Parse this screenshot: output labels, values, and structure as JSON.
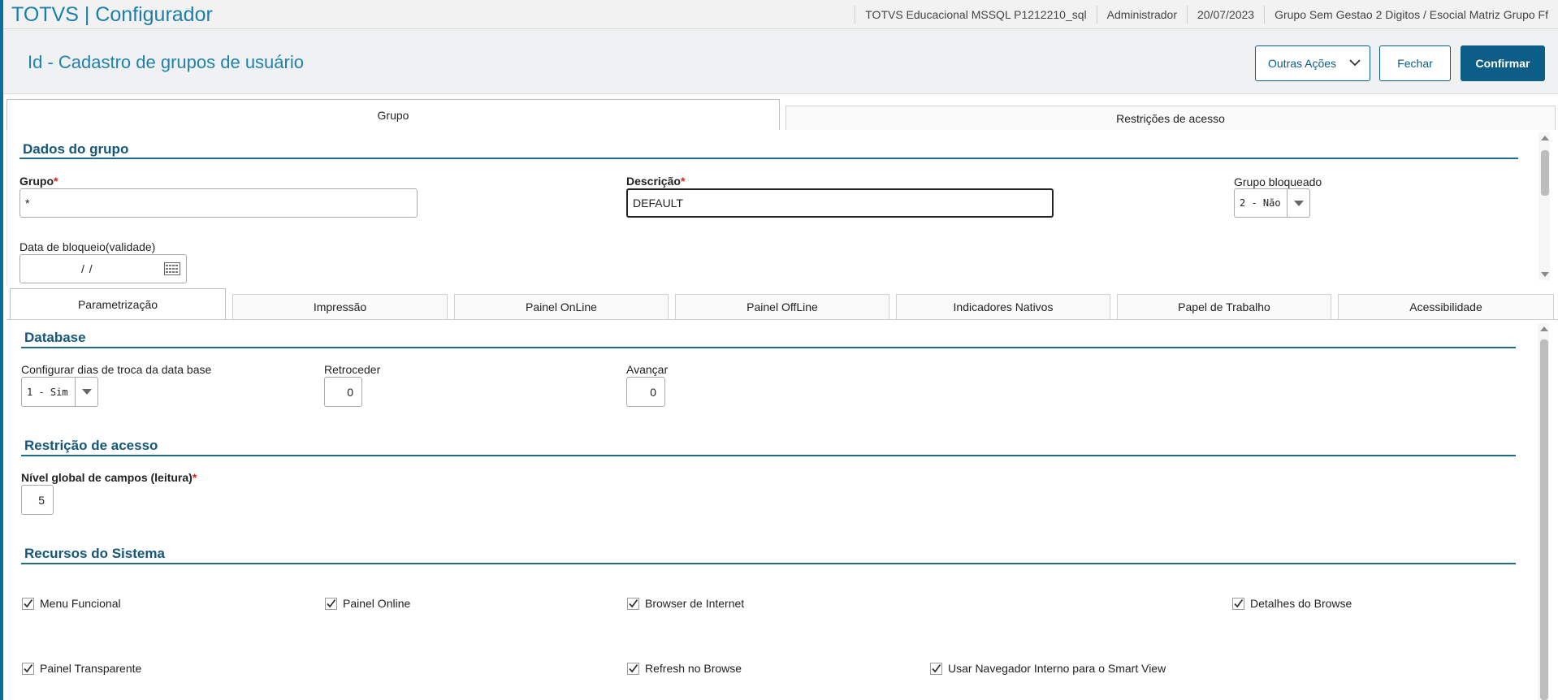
{
  "topbar": {
    "app_title": "TOTVS | Configurador",
    "environment": "TOTVS Educacional MSSQL P1212210_sql",
    "user": "Administrador",
    "date": "20/07/2023",
    "company": "Grupo Sem Gestao 2 Digitos / Esocial Matriz Grupo Ff"
  },
  "header": {
    "title": "Id - Cadastro de grupos de usuário",
    "buttons": {
      "outras": "Outras Ações",
      "fechar": "Fechar",
      "confirmar": "Confirmar"
    }
  },
  "main_tabs": [
    "Grupo",
    "Restrições de acesso"
  ],
  "dados_grupo": {
    "title": "Dados do grupo",
    "grupo_label": "Grupo",
    "grupo_value": "*",
    "descricao_label": "Descrição",
    "descricao_value": "DEFAULT",
    "bloqueado_label": "Grupo bloqueado",
    "bloqueado_value": "2 - Não",
    "data_label": "Data de bloqueio(validade)",
    "data_value": "/ /",
    "required_mark": "*"
  },
  "sub_tabs": [
    "Parametrização",
    "Impressão",
    "Painel OnLine",
    "Painel OffLine",
    "Indicadores Nativos",
    "Papel de Trabalho",
    "Acessibilidade"
  ],
  "database": {
    "title": "Database",
    "config_label": "Configurar dias de troca da data base",
    "config_value": "1 - Sim",
    "retroceder_label": "Retroceder",
    "retroceder_value": "0",
    "avancar_label": "Avançar",
    "avancar_value": "0"
  },
  "restricao": {
    "title": "Restrição de acesso",
    "nivel_label": "Nível global de campos (leitura)",
    "nivel_value": "5",
    "required_mark": "*"
  },
  "recursos": {
    "title": "Recursos do Sistema",
    "items": [
      {
        "label": "Menu Funcional",
        "checked": true
      },
      {
        "label": "Painel Online",
        "checked": true
      },
      {
        "label": "Browser de Internet",
        "checked": true
      },
      {
        "label": "Detalhes do Browse",
        "checked": true
      },
      {
        "label": "Painel Transparente",
        "checked": true
      },
      {
        "label": "Refresh no Browse",
        "checked": true
      },
      {
        "label": "Usar Navegador Interno para o Smart View",
        "checked": true
      }
    ]
  }
}
